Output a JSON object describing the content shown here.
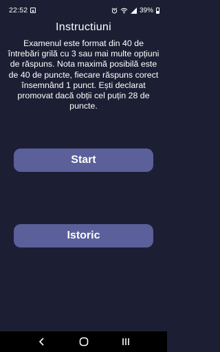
{
  "status_bar": {
    "time": "22:52",
    "battery_percent": "39%",
    "icons": [
      "gallery-icon",
      "alarm-icon",
      "wifi-icon",
      "signal-icon",
      "battery-icon"
    ]
  },
  "main": {
    "title": "Instructiuni",
    "description": "Examenul este format din 40 de întrebări grilă cu 3 sau mai multe opțiuni de răspuns. Nota maximă posibilă este de 40 de puncte, fiecare răspuns corect însemnând 1 punct. Ești declarat promovat dacă obții cel puțin 28 de puncte.",
    "start_label": "Start",
    "history_label": "Istoric"
  },
  "nav_bar": {
    "icons": [
      "back-icon",
      "home-icon",
      "recents-icon"
    ]
  },
  "colors": {
    "background": "#1c1f33",
    "button": "#5b5f9a",
    "text": "#ffffff",
    "nav_background": "#000000"
  }
}
